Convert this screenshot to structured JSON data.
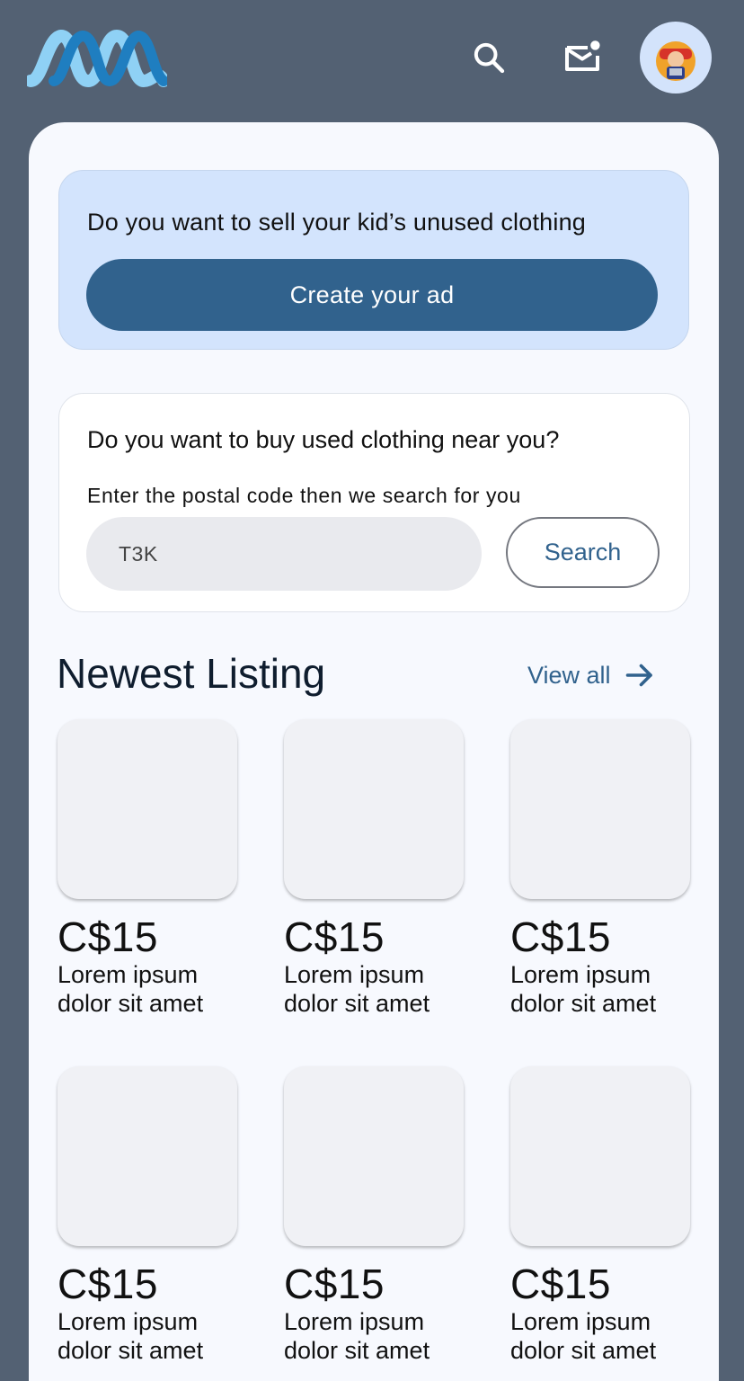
{
  "header": {
    "logo": "logo-mark",
    "icons": {
      "search": "search-icon",
      "mail": "mail-unread-icon",
      "avatar": "user-avatar"
    }
  },
  "sell": {
    "title": "Do you want to sell your kid’s unused clothing",
    "button": "Create your ad"
  },
  "buy": {
    "title": "Do you want to buy used clothing near you?",
    "hint": "Enter the postal code then we search for you",
    "postal_value": "T3K",
    "search_button": "Search"
  },
  "listing": {
    "title": "Newest Listing",
    "view_all": "View all",
    "items": [
      {
        "price": "C$15",
        "line1": "Lorem ipsum",
        "line2": "dolor sit amet"
      },
      {
        "price": "C$15",
        "line1": "Lorem ipsum",
        "line2": "dolor sit amet"
      },
      {
        "price": "C$15",
        "line1": "Lorem ipsum",
        "line2": "dolor sit amet"
      },
      {
        "price": "C$15",
        "line1": "Lorem ipsum",
        "line2": "dolor sit amet"
      },
      {
        "price": "C$15",
        "line1": "Lorem ipsum",
        "line2": "dolor sit amet"
      },
      {
        "price": "C$15",
        "line1": "Lorem ipsum",
        "line2": "dolor sit amet"
      }
    ]
  },
  "colors": {
    "background": "#536173",
    "primary": "#31628d",
    "sell_card": "#d3e4fd",
    "sheet": "#f7f9fe"
  }
}
